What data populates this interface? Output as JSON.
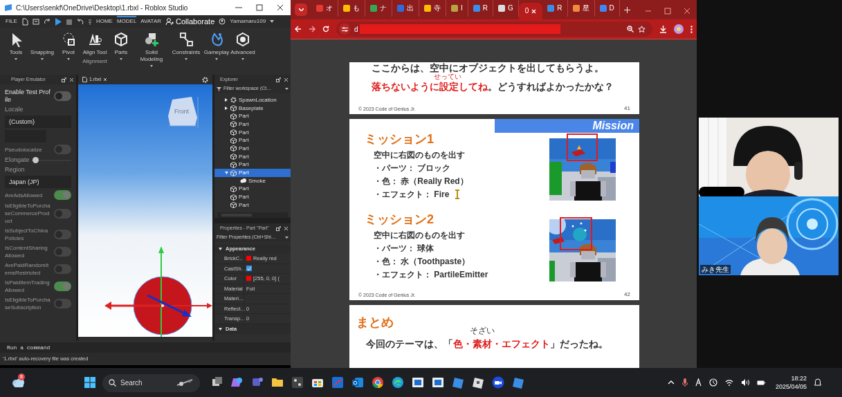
{
  "roblox": {
    "title": "C:\\Users\\senkf\\OneDrive\\Desktop\\1.rbxl - Roblox Studio",
    "file_menu": "FILE",
    "ribbon_tabs": [
      {
        "label": "HOME",
        "selected": false
      },
      {
        "label": "MODEL",
        "selected": true
      },
      {
        "label": "AVATAR",
        "selected": false
      }
    ],
    "collaborate": "Collaborate",
    "user": "Yamamaru109",
    "ribbon": [
      {
        "label": "Tools",
        "dropdown": true
      },
      {
        "label": "Snapping",
        "dropdown": true
      },
      {
        "label": "Pivot",
        "dropdown": true
      },
      {
        "label": "Align Tool",
        "dropdown": false
      },
      {
        "label": "Parts",
        "dropdown": true
      },
      {
        "label": "Solid Modeling",
        "dropdown": true
      },
      {
        "label": "Constraints",
        "dropdown": true
      },
      {
        "label": "Gameplay",
        "dropdown": true
      },
      {
        "label": "Advanced",
        "dropdown": true
      }
    ],
    "ribbon_group": "Alignment",
    "emulator": {
      "title": "Player Emulator",
      "items": [
        {
          "kind": "toggle",
          "label": "Enable Test Profile",
          "on": false
        },
        {
          "kind": "heading",
          "label": "Locale"
        },
        {
          "kind": "field",
          "value": "(Custom)"
        },
        {
          "kind": "field"
        },
        {
          "kind": "toggle",
          "label": "Pseudolocalize",
          "on": false
        },
        {
          "kind": "slider",
          "label": "Elongate",
          "level": 0.05
        },
        {
          "kind": "heading",
          "label": "Region"
        },
        {
          "kind": "field",
          "value": "Japan (JP)"
        },
        {
          "kind": "toggle",
          "label": "AreAdsAllowed",
          "on": true
        },
        {
          "kind": "toggle",
          "label": "IsEligibleToPurchaseCommerceProduct",
          "on": false
        },
        {
          "kind": "toggle",
          "label": "IsSubjectToChinaPolicies",
          "on": false
        },
        {
          "kind": "toggle",
          "label": "IsContentSharingAllowed",
          "on": false
        },
        {
          "kind": "toggle",
          "label": "ArePaidRandomItemsRestricted",
          "on": false
        },
        {
          "kind": "toggle",
          "label": "IsPaidItemTradingAllowed",
          "on": true
        },
        {
          "kind": "toggle",
          "label": "IsEligibleToPurchaseSubscription",
          "on": false
        }
      ]
    },
    "doc_tab": "1.rbxl",
    "view_cube_label": "Front",
    "explorer": {
      "title": "Explorer",
      "placeholder": "Filter workspace (Ct…",
      "items": [
        {
          "label": "SpawnLocation",
          "kind": "spawn",
          "expanded": false,
          "selected": false
        },
        {
          "label": "Baseplate",
          "kind": "part",
          "expanded": false,
          "selected": false
        },
        {
          "label": "Part",
          "kind": "part",
          "selected": false
        },
        {
          "label": "Part",
          "kind": "part",
          "selected": false
        },
        {
          "label": "Part",
          "kind": "part",
          "selected": false
        },
        {
          "label": "Part",
          "kind": "part",
          "selected": false
        },
        {
          "label": "Part",
          "kind": "part",
          "selected": false
        },
        {
          "label": "Part",
          "kind": "part",
          "selected": false
        },
        {
          "label": "Part",
          "kind": "part",
          "selected": false
        },
        {
          "label": "Part",
          "kind": "part",
          "expanded": true,
          "selected": true,
          "children": [
            {
              "label": "Smoke",
              "kind": "smoke",
              "selected": false
            }
          ]
        },
        {
          "label": "Part",
          "kind": "part",
          "selected": false
        },
        {
          "label": "Part",
          "kind": "part",
          "selected": false
        },
        {
          "label": "Part",
          "kind": "part",
          "selected": false
        }
      ]
    },
    "properties": {
      "title": "Properties - Part \"Part\"",
      "placeholder": "Filter Properties (Ctrl+Shi…",
      "sections": [
        {
          "label": "Appearance",
          "expanded": true,
          "rows": [
            {
              "name": "BrickC…",
              "kind": "color",
              "color": "#ff0000",
              "value": "Really red"
            },
            {
              "name": "CastSh…",
              "kind": "check",
              "checked": true
            },
            {
              "name": "Color",
              "kind": "color",
              "color": "#ff0000",
              "value": "[255, 0, 0] ("
            },
            {
              "name": "Material",
              "kind": "text",
              "value": "Foil"
            },
            {
              "name": "Materi…",
              "kind": "text"
            },
            {
              "name": "Reflect…",
              "kind": "text",
              "value": "0"
            },
            {
              "name": "Transp…",
              "kind": "text",
              "value": "0"
            }
          ]
        },
        {
          "label": "Data",
          "expanded": true
        }
      ]
    },
    "command_placeholder": "Run a command",
    "status": "'1.rbxl' auto-recovery file was created"
  },
  "browser": {
    "tabs": [
      {
        "label": "オ",
        "color": "#e53935",
        "selected": false
      },
      {
        "label": "も",
        "color": "#fbbc04",
        "selected": false
      },
      {
        "label": "ナ",
        "color": "#34a853",
        "selected": false
      },
      {
        "label": "出",
        "color": "#2d6cdf",
        "selected": false
      },
      {
        "label": "寺",
        "color": "#fbbc04",
        "selected": false
      },
      {
        "label": "I",
        "color": "#b5a642",
        "selected": false
      },
      {
        "label": "R",
        "color": "#3a8ee6",
        "selected": false
      },
      {
        "label": "G",
        "color": "#dddddd",
        "selected": false
      },
      {
        "label": "0",
        "selected": true
      },
      {
        "label": "R",
        "color": "#3a8ee6",
        "selected": false
      },
      {
        "label": "星",
        "color": "#f08a3c",
        "selected": false
      },
      {
        "label": "D",
        "color": "#4285f4",
        "selected": false
      }
    ],
    "url": "d",
    "slides": [
      {
        "kind": "text",
        "lines": [
          "ここからは、空中にオブジェクトを出してもらうよ。",
          "**落ちないように設定してね**。どうすればよかったかな？"
        ],
        "ruby": "せってい",
        "footer": "© 2023 Code of Genius Jr.",
        "page": "41"
      },
      {
        "kind": "missions",
        "banner": "Mission",
        "missions": [
          {
            "heading": "ミッション1",
            "lines": [
              "空中に右図のものを出す",
              "・パーツ： ブロック",
              "・色： 赤（Really Red）",
              "・エフェクト： Fire"
            ]
          },
          {
            "heading": "ミッション2",
            "lines": [
              "空中に右図のものを出す",
              "・パーツ： 球体",
              "・色： 水（Toothpaste）",
              "・エフェクト： PartileEmitter"
            ]
          }
        ],
        "footer": "© 2023 Code of Genius Jr.",
        "page": "42"
      },
      {
        "kind": "summary",
        "heading": "まとめ",
        "lines": [
          "今回のテーマは、「**色・素材・エフェクト**」だったね。"
        ],
        "ruby": "そざい"
      }
    ]
  },
  "video": {
    "participants": [
      {
        "kind": "picture"
      },
      {
        "kind": "picture",
        "name": "みき先生"
      }
    ]
  },
  "taskbar": {
    "weather_badge": "8",
    "search_placeholder": "Search",
    "time": "18:22",
    "date": "2025/04/05"
  }
}
